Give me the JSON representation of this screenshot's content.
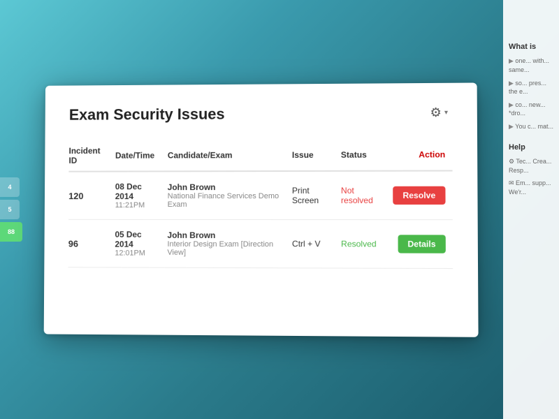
{
  "page": {
    "background": "#4ab8c8"
  },
  "card": {
    "title": "Exam Security Issues"
  },
  "gear_button": {
    "icon": "⚙",
    "chevron": "▾"
  },
  "table": {
    "headers": {
      "incident_id": "Incident ID",
      "datetime": "Date/Time",
      "candidate_exam": "Candidate/Exam",
      "issue": "Issue",
      "status": "Status",
      "action": "Action"
    },
    "rows": [
      {
        "incident_id": "120",
        "date": "08 Dec 2014",
        "time": "11:21PM",
        "candidate_name": "John Brown",
        "exam": "National Finance Services Demo Exam",
        "issue": "Print Screen",
        "status": "Not resolved",
        "status_type": "not-resolved",
        "action_label": "Resolve"
      },
      {
        "incident_id": "96",
        "date": "05 Dec 2014",
        "time": "12:01PM",
        "candidate_name": "John Brown",
        "exam": "Interior Design Exam [Direction View]",
        "issue": "Ctrl + V",
        "status": "Resolved",
        "status_type": "resolved",
        "action_label": "Details"
      }
    ]
  },
  "right_panel": {
    "section_title": "What is",
    "items": [
      "If one... with... same...",
      "If so... pres... the e...",
      "It co... new i... *dro...",
      "You c... mat..."
    ],
    "help_title": "Help",
    "help_items": [
      "Tec... Crea... Resp...",
      "Em... supp... We'r..."
    ]
  },
  "left_tabs": [
    {
      "label": "4"
    },
    {
      "label": "5"
    },
    {
      "label": "88",
      "active": true
    }
  ]
}
